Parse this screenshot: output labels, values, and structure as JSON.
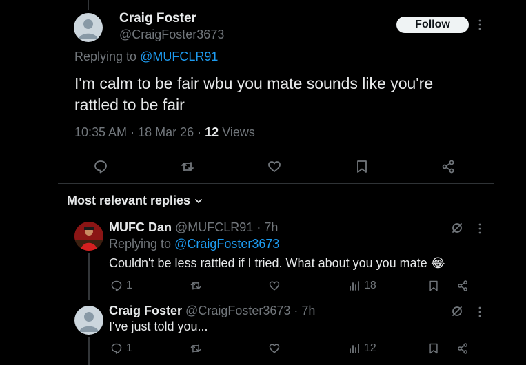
{
  "main_post": {
    "author_name": "Craig Foster",
    "author_handle": "@CraigFoster3673",
    "follow_label": "Follow",
    "replying_prefix": "Replying to",
    "replying_handle": "@MUFCLR91",
    "text_line1": "I'm calm to be fair wbu you mate sounds like you're",
    "text_line2": "rattled to be fair",
    "time": "10:35 AM",
    "date": "18 Mar 26",
    "views_count": "12",
    "views_label": "Views"
  },
  "replies_header": {
    "label": "Most relevant replies"
  },
  "replies": [
    {
      "author_name": "MUFC Dan",
      "author_handle": "@MUFCLR91",
      "time": "7h",
      "replying_prefix": "Replying to",
      "replying_handle": "@CraigFoster3673",
      "text": "Couldn't be less rattled if I tried. What about you you mate",
      "emoji": "😂",
      "reply_count": "1",
      "retweet_count": "",
      "like_count": "",
      "views_count": "18"
    },
    {
      "author_name": "Craig Foster",
      "author_handle": "@CraigFoster3673",
      "time": "7h",
      "text": "I've just told you...",
      "reply_count": "1",
      "retweet_count": "",
      "like_count": "",
      "views_count": "12"
    }
  ],
  "separator": "·",
  "colors": {
    "background": "#000000",
    "text": "#e7e9ea",
    "muted": "#71767b",
    "link": "#1d9bf0",
    "divider": "#2f3336"
  }
}
